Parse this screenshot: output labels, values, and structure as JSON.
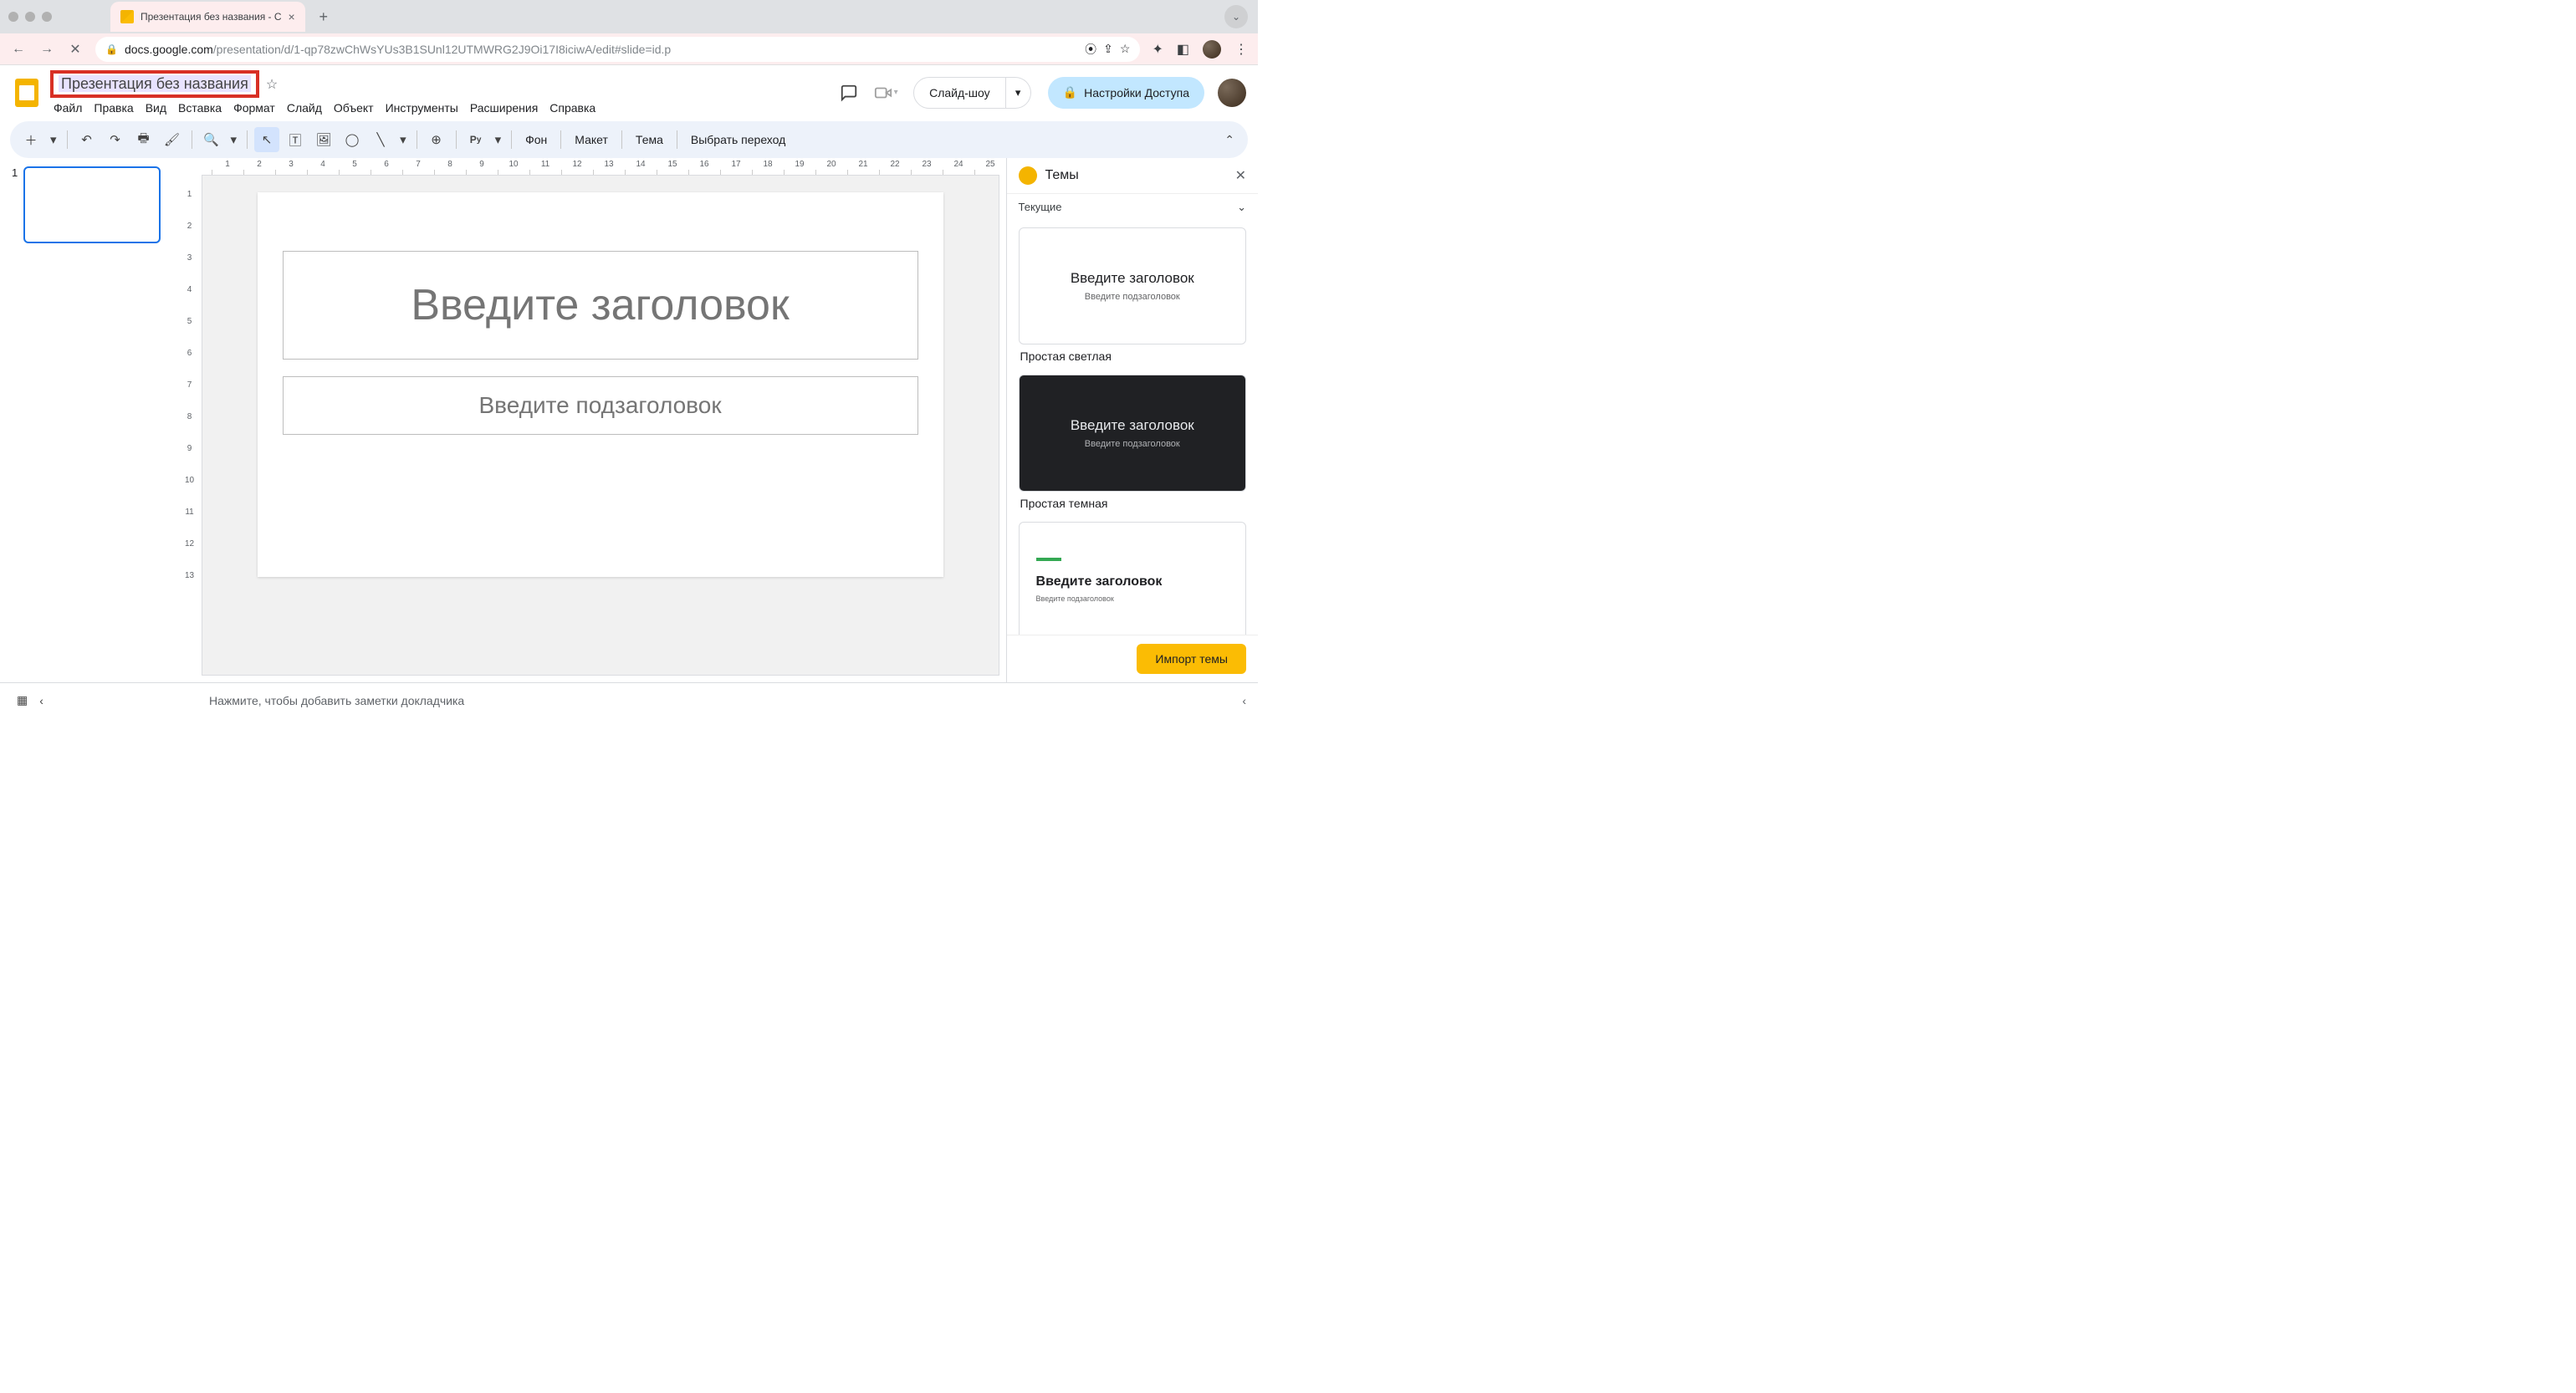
{
  "browser": {
    "tab_title": "Презентация без названия - С",
    "url_host": "docs.google.com",
    "url_path": "/presentation/d/1-qp78zwChWsYUs3B1SUnl12UTMWRG2J9Oi17I8iciwA/edit#slide=id.p"
  },
  "header": {
    "doc_title": "Презентация без названия",
    "menus": [
      "Файл",
      "Правка",
      "Вид",
      "Вставка",
      "Формат",
      "Слайд",
      "Объект",
      "Инструменты",
      "Расширения",
      "Справка"
    ],
    "slideshow": "Слайд-шоу",
    "share": "Настройки Доступа"
  },
  "toolbar": {
    "background": "Фон",
    "layout": "Макет",
    "theme": "Тема",
    "transition": "Выбрать переход"
  },
  "ruler_h": [
    "1",
    "2",
    "3",
    "4",
    "5",
    "6",
    "7",
    "8",
    "9",
    "10",
    "11",
    "12",
    "13",
    "14",
    "15",
    "16",
    "17",
    "18",
    "19",
    "20",
    "21",
    "22",
    "23",
    "24",
    "25"
  ],
  "ruler_v": [
    "1",
    "2",
    "3",
    "4",
    "5",
    "6",
    "7",
    "8",
    "9",
    "10",
    "11",
    "12",
    "13"
  ],
  "filmstrip": {
    "slide_number": "1"
  },
  "slide": {
    "title_placeholder": "Введите заголовок",
    "subtitle_placeholder": "Введите подзаголовок"
  },
  "themes": {
    "title": "Темы",
    "current": "Текущие",
    "cards": [
      {
        "title": "Введите заголовок",
        "sub": "Введите подзаголовок",
        "label": "Простая светлая"
      },
      {
        "title": "Введите заголовок",
        "sub": "Введите подзаголовок",
        "label": "Простая темная"
      },
      {
        "title": "Введите заголовок",
        "sub": "Введите подзаголовок",
        "label": ""
      }
    ],
    "import": "Импорт темы"
  },
  "notes": {
    "placeholder": "Нажмите, чтобы добавить заметки докладчика"
  }
}
